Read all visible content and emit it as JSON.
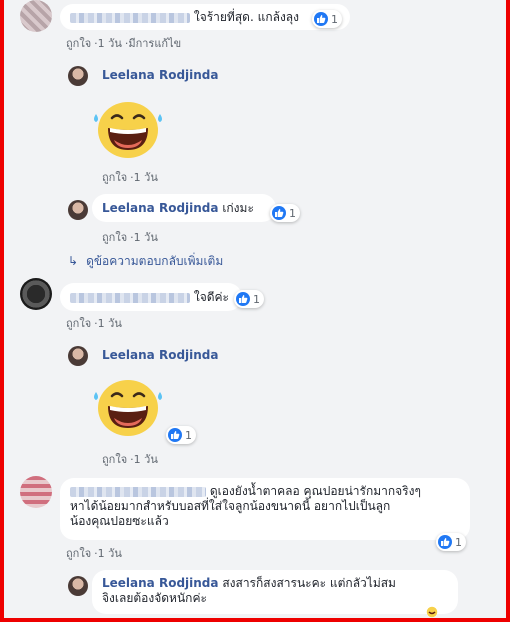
{
  "comments": {
    "c1": {
      "text": "ใจร้ายที่สุด. แกล้งลุง",
      "like": "ถูกใจ",
      "time": "1 วัน",
      "edited": "มีการแก้ไข",
      "count": "1"
    },
    "r1": {
      "name": "Leelana Rodjinda",
      "like": "ถูกใจ",
      "time": "1 วัน"
    },
    "r2": {
      "name": "Leelana Rodjinda",
      "text": "เก่งมะ",
      "like": "ถูกใจ",
      "time": "1 วัน",
      "count": "1"
    },
    "more_replies": "ดูข้อความตอบกลับเพิ่มเติม",
    "c2": {
      "text": "ใจดีค่ะ",
      "like": "ถูกใจ",
      "time": "1 วัน",
      "count": "1"
    },
    "r3": {
      "name": "Leelana Rodjinda",
      "like": "ถูกใจ",
      "time": "1 วัน",
      "count": "1"
    },
    "c3": {
      "line1": "ดูเองยังน้ำตาคลอ คุณปอยน่ารักมากจริงๆ",
      "line2": "หาได้น้อยมากสำหรับบอสที่ใส่ใจลูกน้องขนาดนี้ อยากไปเป็นลูก",
      "line3": "น้องคุณปอยซะแล้ว",
      "like": "ถูกใจ",
      "time": "1 วัน",
      "count": "1"
    },
    "r4": {
      "name": "Leelana Rodjinda",
      "line1": "สงสารก็สงสารนะคะ แต่กลัวไม่สม",
      "line2": "จิงเลยต้องจัดหนักค่ะ"
    }
  },
  "separator": "·",
  "colors": {
    "name": "#385898",
    "meta": "#606770",
    "bubble": "#ffffff",
    "background": "#f2f3f5",
    "like": "#2078f4",
    "border": "#ee0000"
  },
  "icons": [
    "like-icon",
    "laughing-emoji-icon",
    "reply-arrow-icon"
  ]
}
